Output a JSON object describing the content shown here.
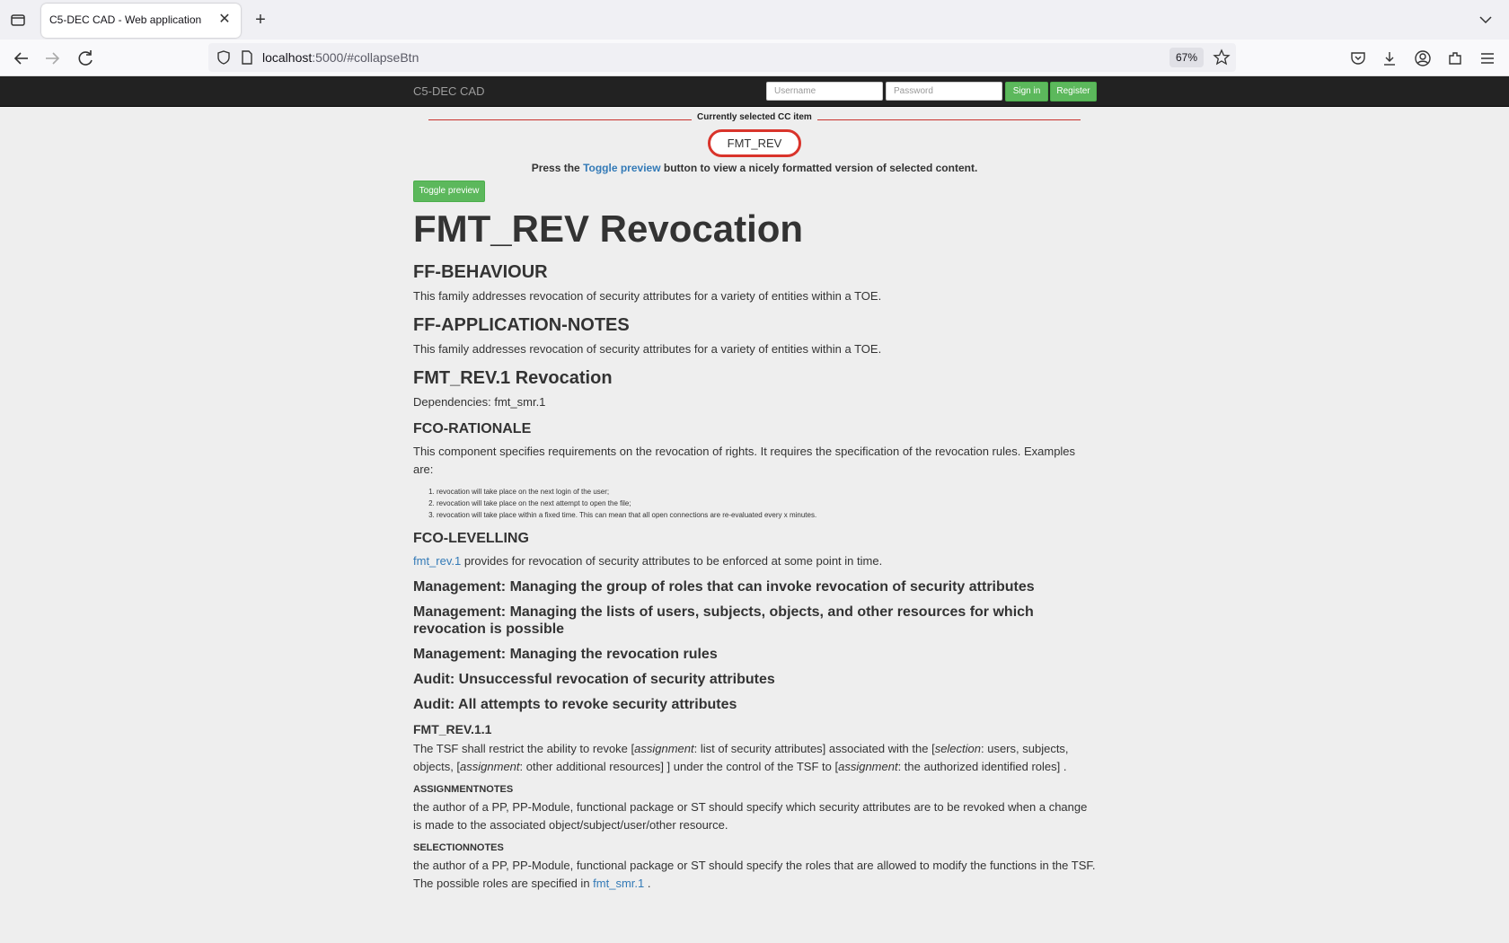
{
  "browser": {
    "tab_title": "C5-DEC CAD - Web application",
    "url_host": "localhost",
    "url_rest": ":5000/#collapseBtn",
    "zoom": "67%"
  },
  "app": {
    "brand": "C5-DEC CAD",
    "username_placeholder": "Username",
    "password_placeholder": "Password",
    "signin_label": "Sign in",
    "register_label": "Register"
  },
  "selection": {
    "label": "Currently selected CC item",
    "item": "FMT_REV",
    "hint_prefix": "Press the ",
    "hint_link": "Toggle preview",
    "hint_suffix": " button to view a nicely formatted version of selected content.",
    "toggle_label": "Toggle preview"
  },
  "doc": {
    "title": "FMT_REV Revocation",
    "behaviour_heading": "FF-BEHAVIOUR",
    "behaviour_text": "This family addresses revocation of security attributes for a variety of entities within a TOE.",
    "appnotes_heading": "FF-APPLICATION-NOTES",
    "appnotes_text": "This family addresses revocation of security attributes for a variety of entities within a TOE.",
    "component_heading": "FMT_REV.1 Revocation",
    "dependencies": "Dependencies: fmt_smr.1",
    "rationale_heading": "FCO-RATIONALE",
    "rationale_text": "This component specifies requirements on the revocation of rights. It requires the specification of the revocation rules. Examples are:",
    "examples": [
      "revocation will take place on the next login of the user;",
      "revocation will take place on the next attempt to open the file;",
      "revocation will take place within a fixed time. This can mean that all open connections are re-evaluated every x minutes."
    ],
    "levelling_heading": "FCO-LEVELLING",
    "levelling_link": "fmt_rev.1",
    "levelling_text": " provides for revocation of security attributes to be enforced at some point in time.",
    "mgmt1": "Management: Managing the group of roles that can invoke revocation of security attributes",
    "mgmt2": "Management: Managing the lists of users, subjects, objects, and other resources for which revocation is possible",
    "mgmt3": "Management: Managing the revocation rules",
    "audit1": "Audit: Unsuccessful revocation of security attributes",
    "audit2": "Audit: All attempts to revoke security attributes",
    "element_heading": "FMT_REV.1.1",
    "element_text": {
      "t1": "The TSF shall restrict the ability to revoke [",
      "i1": "assignment",
      "t2": ": list of security attributes] associated with the [",
      "i2": "selection",
      "t3": ": users, subjects, objects, [",
      "i3": "assignment",
      "t4": ": other additional resources] ] under the control of the TSF to [",
      "i4": "assignment",
      "t5": ": the authorized identified roles] ."
    },
    "assignment_notes_heading": "ASSIGNMENTNOTES",
    "assignment_notes_text": "the author of a PP, PP-Module, functional package or ST should specify which security attributes are to be revoked when a change is made to the associated object/subject/user/other resource.",
    "selection_notes_heading": "SELECTIONNOTES",
    "selection_notes_text": "the author of a PP, PP-Module, functional package or ST should specify the roles that are allowed to modify the functions in the TSF. The possible roles are specified in ",
    "selection_notes_link": "fmt_smr.1",
    "selection_notes_end": " ."
  }
}
